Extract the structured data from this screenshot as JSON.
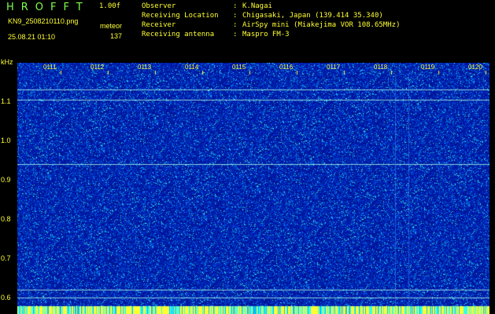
{
  "header": {
    "logo": "HROFFT",
    "version": "1.00f",
    "filename": "KN9_2508210110.png",
    "meteor_label": "meteor",
    "datetime": "25.08.21 01:10",
    "meteor_count": "137"
  },
  "info": [
    {
      "key": "Observer",
      "value": "K.Nagai"
    },
    {
      "key": "Receiving Location",
      "value": "Chigasaki, Japan (139.414 35.340)"
    },
    {
      "key": "Receiver",
      "value": "AirSpy mini (Miakejima VOR 108.65MHz)"
    },
    {
      "key": "Receiving antenna",
      "value": "Maspro FM-3"
    }
  ],
  "spectrogram": {
    "y_unit": "kHz",
    "y_ticks": [
      "1.1",
      "1.0",
      "0.9",
      "0.8",
      "0.7",
      "0.6"
    ],
    "time_ticks": [
      "0111",
      "0112",
      "0113",
      "0114",
      "0115",
      "0116",
      "0117",
      "0118",
      "0119",
      "0120"
    ],
    "colors": {
      "background": "#001a9a",
      "label": "#ffff33"
    }
  }
}
